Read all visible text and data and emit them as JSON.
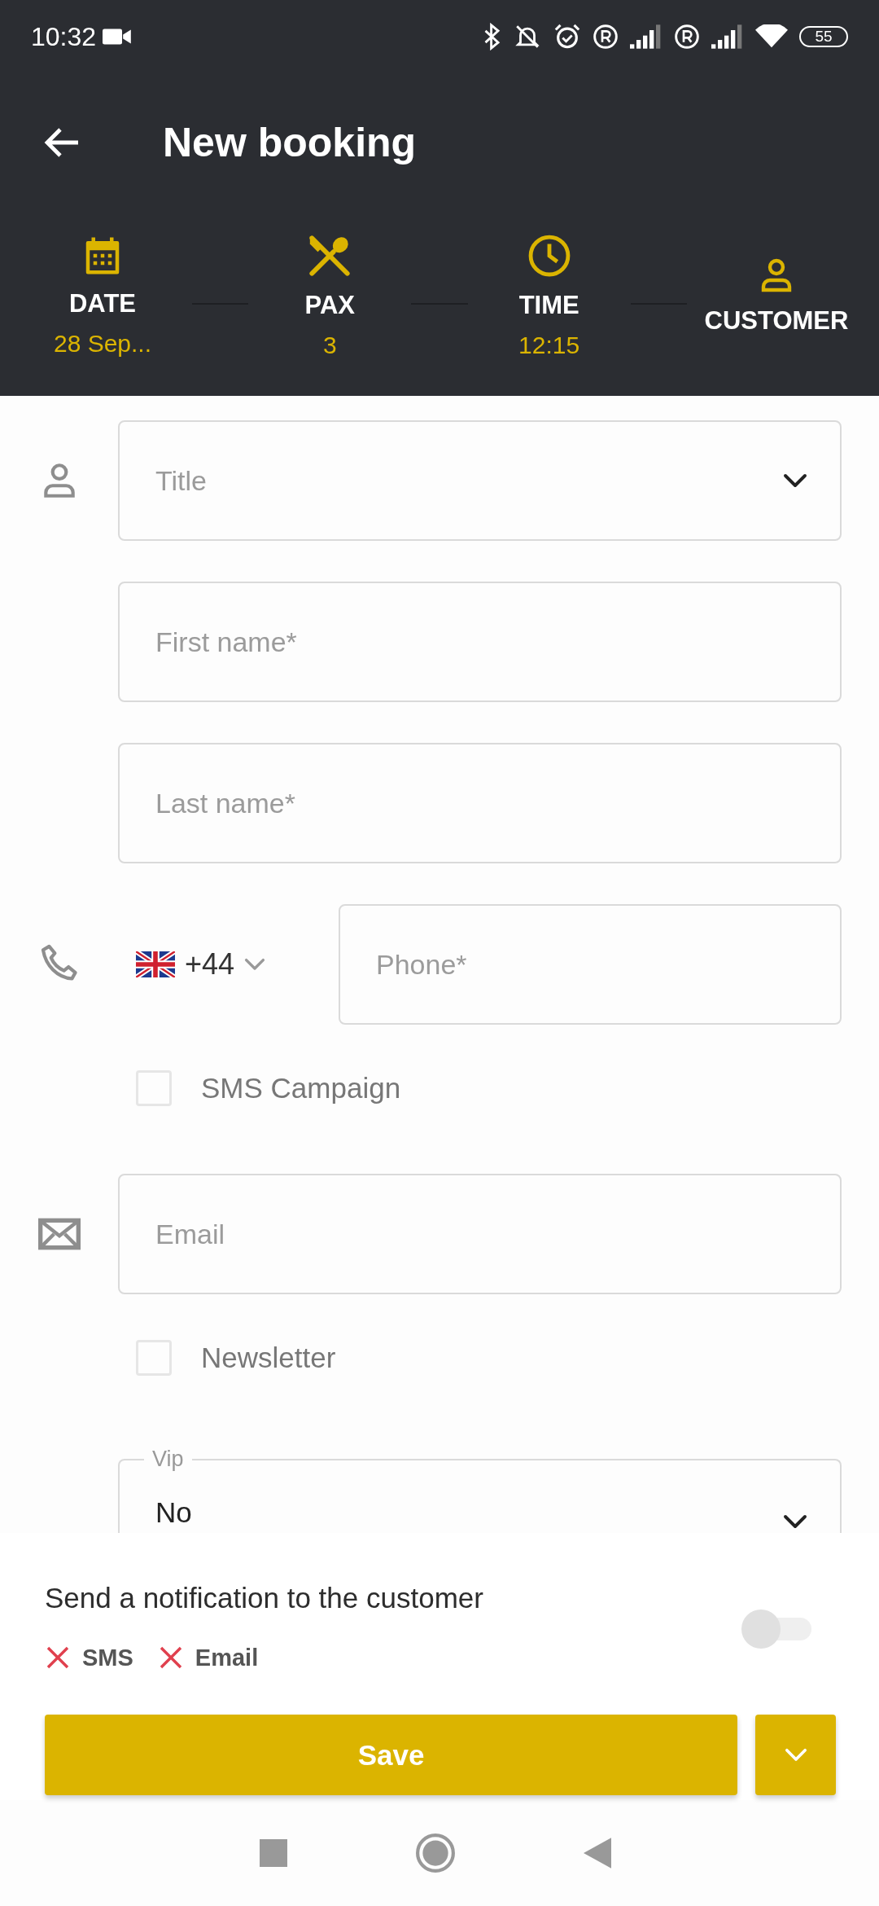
{
  "status_bar": {
    "time": "10:32",
    "battery": "55"
  },
  "header": {
    "title": "New booking"
  },
  "steps": [
    {
      "kind": "date",
      "label": "DATE",
      "value": "28 Sep..."
    },
    {
      "kind": "pax",
      "label": "PAX",
      "value": "3"
    },
    {
      "kind": "time",
      "label": "TIME",
      "value": "12:15"
    },
    {
      "kind": "customer",
      "label": "CUSTOMER"
    }
  ],
  "form": [
    {
      "kind": "person",
      "rows": [
        {
          "kind": "select",
          "placeholder": "Title"
        },
        {
          "kind": "text",
          "placeholder": "First name*"
        },
        {
          "kind": "text",
          "placeholder": "Last name*"
        }
      ]
    },
    {
      "kind": "phone",
      "rows": [
        {
          "kind": "phone",
          "country_code": "+44",
          "placeholder": "Phone*"
        },
        {
          "kind": "checkbox",
          "label": "SMS Campaign",
          "checked": false
        }
      ]
    },
    {
      "kind": "email",
      "rows": [
        {
          "kind": "text",
          "placeholder": "Email"
        },
        {
          "kind": "checkbox",
          "label": "Newsletter",
          "checked": false
        }
      ]
    },
    {
      "kind": "other",
      "rows": [
        {
          "kind": "outlined_select",
          "label": "Vip",
          "value": "No"
        }
      ]
    }
  ],
  "notification": {
    "label": "Send a notification to the customer",
    "on": false,
    "channels": [
      {
        "label": "SMS",
        "checked": false
      },
      {
        "label": "Email",
        "checked": false
      }
    ]
  },
  "save_button": {
    "label": "Save"
  }
}
